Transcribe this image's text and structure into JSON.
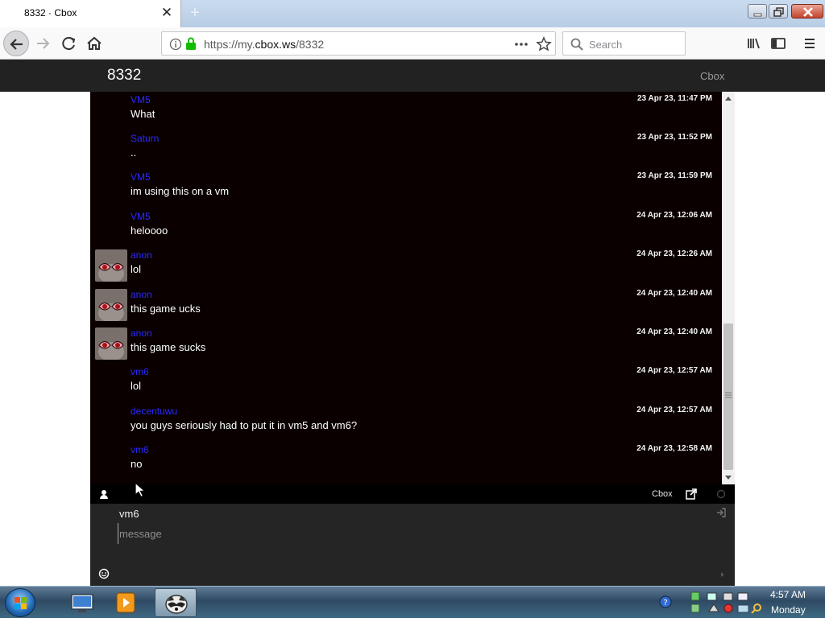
{
  "browser": {
    "tab_title": "8332 · Cbox",
    "url_prefix": "https://my.",
    "url_domain": "cbox.ws",
    "url_path": "/8332",
    "search_placeholder": "Search"
  },
  "page": {
    "title": "8332",
    "brand_link": "Cbox"
  },
  "chat": {
    "messages": [
      {
        "user": "VM5",
        "text": "What",
        "time": "23 Apr 23, 11:47 PM",
        "avatar": false
      },
      {
        "user": "Saturn",
        "text": "..",
        "time": "23 Apr 23, 11:52 PM",
        "avatar": false
      },
      {
        "user": "VM5",
        "text": "im using this on a vm",
        "time": "23 Apr 23, 11:59 PM",
        "avatar": false
      },
      {
        "user": "VM5",
        "text": "heloooo",
        "time": "24 Apr 23, 12:06 AM",
        "avatar": false
      },
      {
        "user": "anon",
        "text": "lol",
        "time": "24 Apr 23, 12:26 AM",
        "avatar": true
      },
      {
        "user": "anon",
        "text": "this game ucks",
        "time": "24 Apr 23, 12:40 AM",
        "avatar": true
      },
      {
        "user": "anon",
        "text": "this game sucks",
        "time": "24 Apr 23, 12:40 AM",
        "avatar": true
      },
      {
        "user": "vm6",
        "text": "lol",
        "time": "24 Apr 23, 12:57 AM",
        "avatar": false
      },
      {
        "user": "decentuwu",
        "text": "you guys seriously had to put it in vm5 and vm6?",
        "time": "24 Apr 23, 12:57 AM",
        "avatar": false
      },
      {
        "user": "vm6",
        "text": "no",
        "time": "24 Apr 23, 12:58 AM",
        "avatar": false
      }
    ],
    "toolbar_brand": "Cbox",
    "composer_name": "vm6",
    "message_placeholder": "message"
  },
  "taskbar": {
    "time": "4:57 AM",
    "day": "Monday"
  },
  "colors": {
    "username": "#2a2aff",
    "chat_bg": "#0a0000",
    "header_bg": "#222222"
  }
}
